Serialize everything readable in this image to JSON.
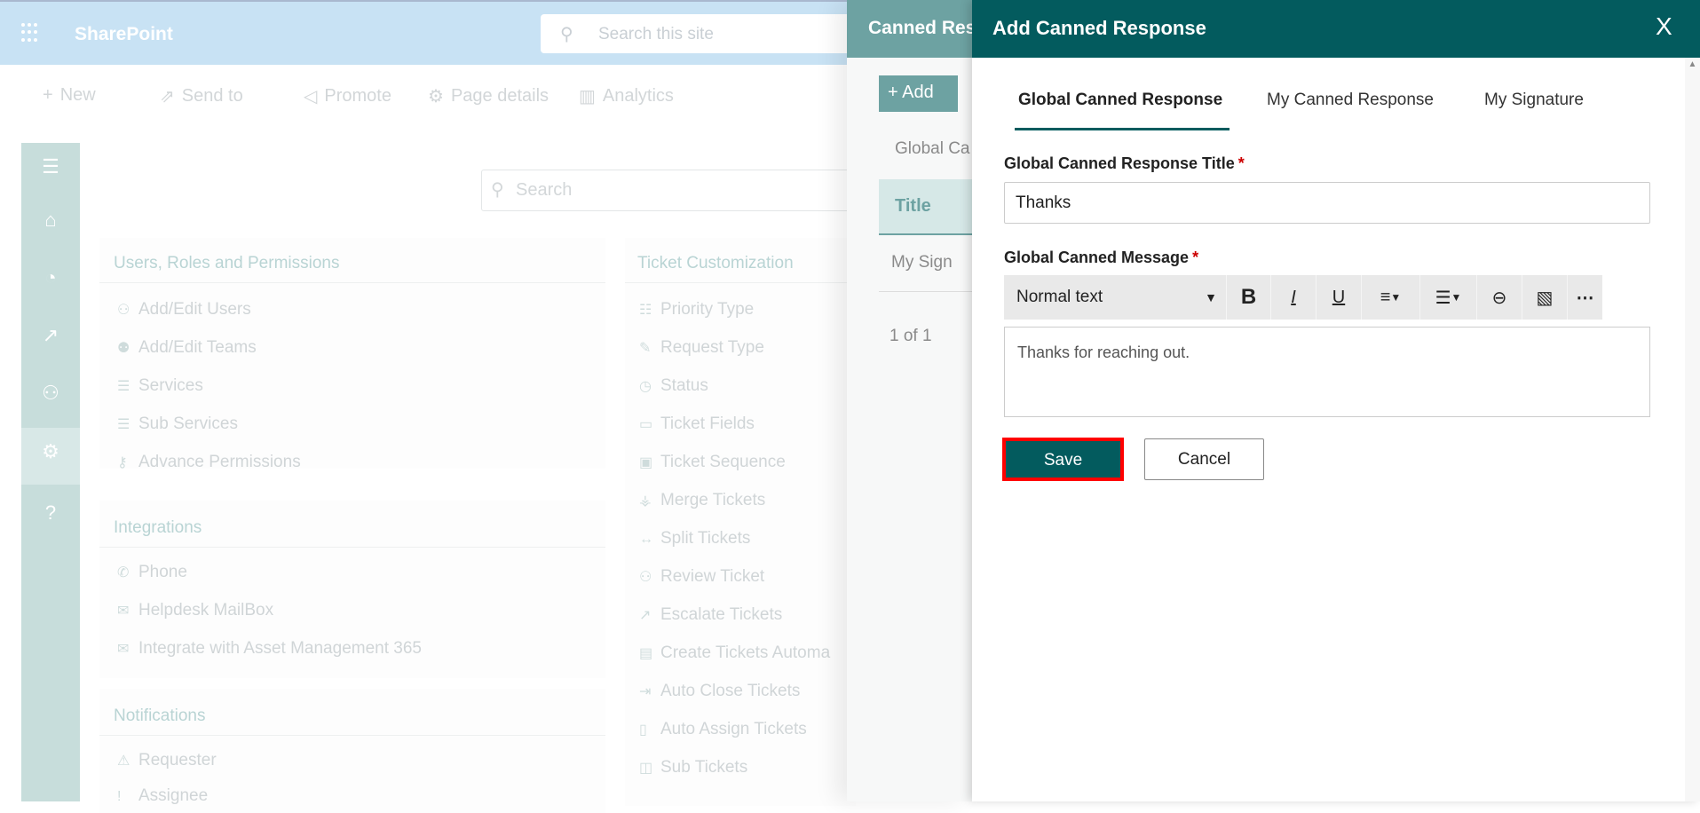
{
  "topbar": {
    "brand": "SharePoint",
    "search_placeholder": "Search this site"
  },
  "commands": [
    "New",
    "Send to",
    "Promote",
    "Page details",
    "Analytics"
  ],
  "content": {
    "search_placeholder": "Search",
    "sections": [
      {
        "title": "Users, Roles and Permissions",
        "items": [
          "Add/Edit Users",
          "Add/Edit Teams",
          "Services",
          "Sub Services",
          "Advance Permissions"
        ]
      },
      {
        "title": "Integrations",
        "items": [
          "Phone",
          "Helpdesk MailBox",
          "Integrate with Asset Management 365"
        ]
      },
      {
        "title": "Notifications",
        "items": [
          "Requester",
          "Assignee"
        ]
      },
      {
        "title": "Ticket Customization",
        "items": [
          "Priority Type",
          "Request Type",
          "Status",
          "Ticket Fields",
          "Ticket Sequence",
          "Merge Tickets",
          "Split Tickets",
          "Review Ticket",
          "Escalate Tickets",
          "Create Tickets Automa",
          "Auto Close Tickets",
          "Auto Assign Tickets",
          "Sub Tickets"
        ]
      }
    ]
  },
  "mid_panel": {
    "title": "Canned Res",
    "add": "Add",
    "tab": "Global Ca",
    "col_title": "Title",
    "row": "My Sign",
    "pager": "1 of 1"
  },
  "dialog": {
    "title": "Add Canned Response",
    "close": "X",
    "tabs": [
      "Global Canned Response",
      "My Canned Response",
      "My Signature"
    ],
    "title_label": "Global Canned Response Title",
    "required": "*",
    "title_value": "Thanks",
    "message_label": "Global Canned Message",
    "format": "Normal text",
    "message_value": "Thanks for reaching out.",
    "save": "Save",
    "cancel": "Cancel"
  },
  "colors": {
    "teal": "#035b5e",
    "highlight": "#ff0000"
  }
}
